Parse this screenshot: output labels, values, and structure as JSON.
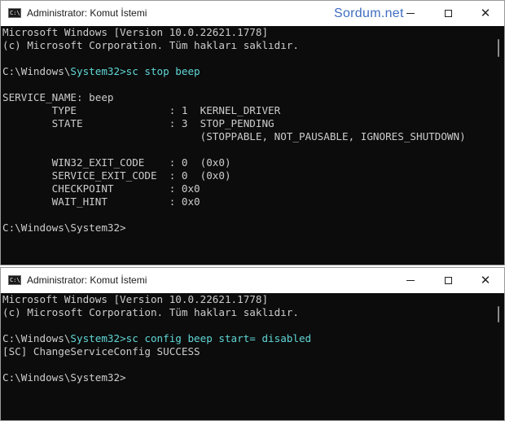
{
  "windows": [
    {
      "title": "Administrator: Komut İstemi",
      "watermark": "Sordum.net",
      "lines": [
        {
          "text": "Microsoft Windows [Version 10.0.22621.1778]"
        },
        {
          "text": "(c) Microsoft Corporation. Tüm hakları saklıdır."
        },
        {
          "text": ""
        },
        {
          "prompt_pre": "C:\\Windows\\",
          "prompt_hl": "System32>sc stop beep"
        },
        {
          "text": ""
        },
        {
          "text": "SERVICE_NAME: beep"
        },
        {
          "text": "        TYPE               : 1  KERNEL_DRIVER"
        },
        {
          "text": "        STATE              : 3  STOP_PENDING"
        },
        {
          "text": "                                (STOPPABLE, NOT_PAUSABLE, IGNORES_SHUTDOWN)"
        },
        {
          "text": ""
        },
        {
          "text": "        WIN32_EXIT_CODE    : 0  (0x0)"
        },
        {
          "text": "        SERVICE_EXIT_CODE  : 0  (0x0)"
        },
        {
          "text": "        CHECKPOINT         : 0x0"
        },
        {
          "text": "        WAIT_HINT          : 0x0"
        },
        {
          "text": ""
        },
        {
          "text": "C:\\Windows\\System32>"
        }
      ]
    },
    {
      "title": "Administrator: Komut İstemi",
      "lines": [
        {
          "text": "Microsoft Windows [Version 10.0.22621.1778]"
        },
        {
          "text": "(c) Microsoft Corporation. Tüm hakları saklıdır."
        },
        {
          "text": ""
        },
        {
          "prompt_pre": "C:\\Windows\\",
          "prompt_hl": "System32>sc config beep start= disabled"
        },
        {
          "text": "[SC] ChangeServiceConfig SUCCESS"
        },
        {
          "text": ""
        },
        {
          "text": "C:\\Windows\\System32>"
        }
      ]
    }
  ],
  "colors": {
    "console_bg": "#0c0c0c",
    "console_text": "#cccccc",
    "command_highlight": "#61d6d6",
    "watermark": "#3f6ec0"
  },
  "icons": {
    "app": "cmd-icon",
    "minimize": "minimize-icon",
    "maximize": "maximize-icon",
    "close": "close-icon"
  }
}
